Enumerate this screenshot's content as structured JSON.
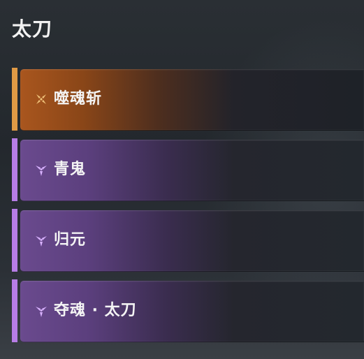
{
  "title": "太刀",
  "skills": [
    {
      "name": "噬魂斩",
      "icon": "quad-petal-icon",
      "color": "#e09a45"
    },
    {
      "name": "青鬼",
      "icon": "tri-petal-icon",
      "color": "#b77de6"
    },
    {
      "name": "归元",
      "icon": "tri-petal-icon",
      "color": "#b77de6"
    },
    {
      "name": "夺魂 · 太刀",
      "icon": "tri-petal-icon",
      "color": "#b77de6"
    }
  ]
}
